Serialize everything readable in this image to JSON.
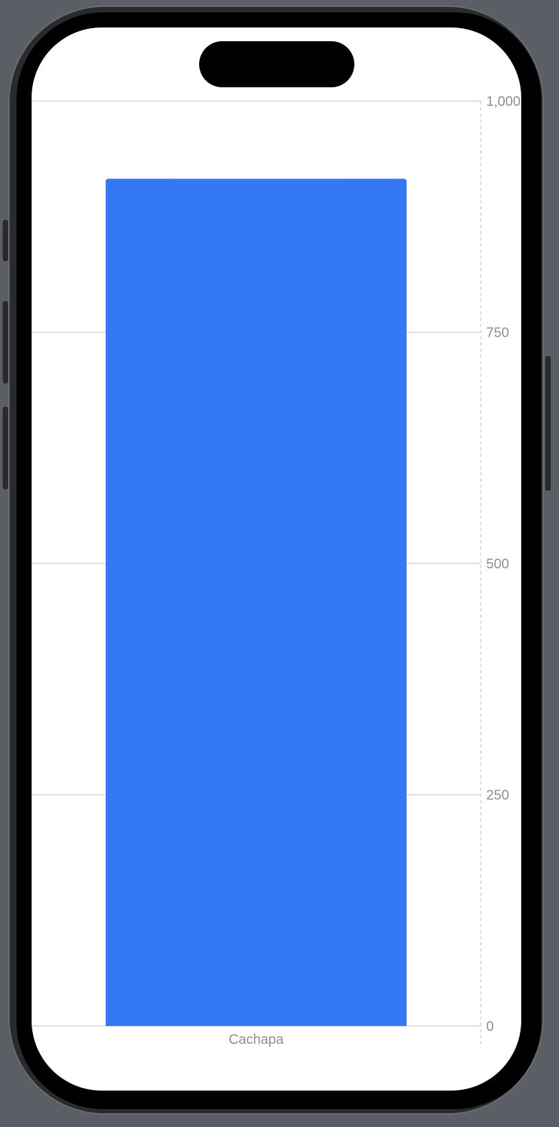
{
  "chart_data": {
    "type": "bar",
    "categories": [
      "Cachapa"
    ],
    "values": [
      916
    ],
    "ylim": [
      0,
      1000
    ],
    "yticks": [
      0,
      250,
      500,
      750,
      1000
    ],
    "ytick_labels": [
      "0",
      "250",
      "500",
      "750",
      "1,000"
    ],
    "y_axis_side": "right",
    "grid": true,
    "bar_color": "#3478f6"
  },
  "colors": {
    "bar": "#3478f6",
    "gridline": "#d6d6d8",
    "axis_label": "#8e8e93",
    "screen_background": "#ffffff",
    "device_background": "#5a5f66"
  }
}
